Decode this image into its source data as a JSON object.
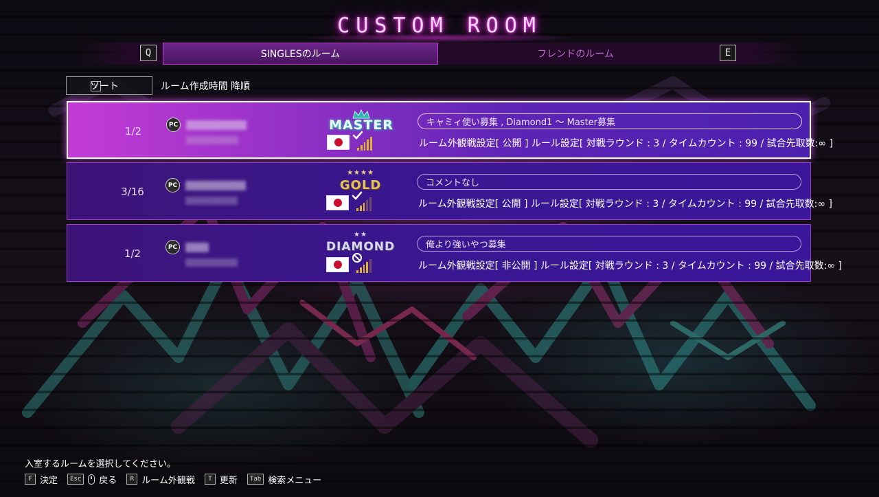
{
  "title": "CUSTOM ROOM",
  "tabs": {
    "prev_key": "Q",
    "next_key": "E",
    "active_label": "SINGLESのルーム",
    "inactive_label": "フレンドのルーム"
  },
  "sort": {
    "key": "V",
    "label": "ソート",
    "value": "ルーム作成時間  降順"
  },
  "rooms": [
    {
      "count": "1/2",
      "platform": "PC",
      "rank": "MASTER",
      "rank_stars": "",
      "flag_icon": "japan-flag-icon",
      "status_icon": "check-icon",
      "signal_bars": 5,
      "comment": "キャミィ使い募集 , Diamond1 ～ Master募集",
      "settings": "ルーム外観戦設定[ 公開 ] ルール設定[ 対戦ラウンド : 3 / タイムカウント : 99 / 試合先取数:∞ ]"
    },
    {
      "count": "3/16",
      "platform": "PC",
      "rank": "GOLD",
      "rank_stars": "★★★★",
      "flag_icon": "japan-flag-icon",
      "status_icon": "check-icon",
      "signal_bars": 3,
      "comment": "コメントなし",
      "settings": "ルーム外観戦設定[ 公開 ] ルール設定[ 対戦ラウンド : 3 / タイムカウント : 99 / 試合先取数:∞ ]"
    },
    {
      "count": "1/2",
      "platform": "PC",
      "rank": "DIAMOND",
      "rank_stars": "★★",
      "flag_icon": "japan-flag-icon",
      "status_icon": "no-entry-icon",
      "signal_bars": 4,
      "comment": "俺より強いやつ募集",
      "settings": "ルーム外観戦設定[ 非公開 ] ルール設定[ 対戦ラウンド : 3 / タイムカウント : 99 / 試合先取数:∞ ]"
    }
  ],
  "footer": {
    "hint": "入室するルームを選択してください。",
    "controls": [
      {
        "key": "F",
        "label": "決定"
      },
      {
        "key": "Esc",
        "label": "戻る"
      },
      {
        "key": "R",
        "label": "ルーム外観戦"
      },
      {
        "key": "T",
        "label": "更新"
      },
      {
        "key": "Tab",
        "label": "検索メニュー"
      }
    ]
  },
  "colors": {
    "accent": "#c43dd6",
    "title_glow": "#e02bd8",
    "room_bg": "#3a1792",
    "selected_room": "#c43bd6",
    "signal": "#e0b52a"
  }
}
